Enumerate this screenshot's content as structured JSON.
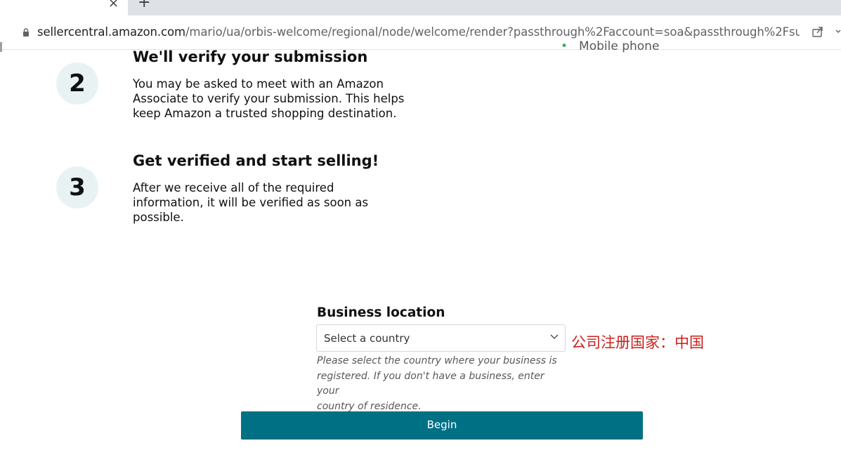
{
  "browser": {
    "tab_close": "×",
    "new_tab": "+",
    "url_host": "sellercentral.amazon.com",
    "url_path": "/mario/ua/orbis-welcome/regional/node/welcome/render?passthrough%2Faccount=soa&passthrough%2Fsup…",
    "icons": [
      "lock-icon",
      "share-icon",
      "chevron-down-icon"
    ]
  },
  "partial_list_item": "Mobile phone",
  "steps": [
    {
      "number": "2",
      "title": "We'll verify your submission",
      "lines": [
        "You may be asked to meet with an Amazon",
        "Associate to verify your submission. This helps",
        "keep Amazon a trusted shopping destination."
      ]
    },
    {
      "number": "3",
      "title": "Get verified and start selling!",
      "lines": [
        "After we receive all of the required",
        "information, it will be verified as soon as",
        "possible."
      ]
    }
  ],
  "business_location": {
    "label": "Business location",
    "select_placeholder": "Select a country",
    "helper_lines": [
      "Please select the country where your business is",
      "registered. If you don't have a business, enter your",
      "country of residence."
    ]
  },
  "annotation": "公司注册国家：中国",
  "begin_button": "Begin",
  "colors": {
    "accent": "#007185",
    "annotation_red": "#cc1f1a",
    "step_circle_bg": "#e8f2f2"
  }
}
